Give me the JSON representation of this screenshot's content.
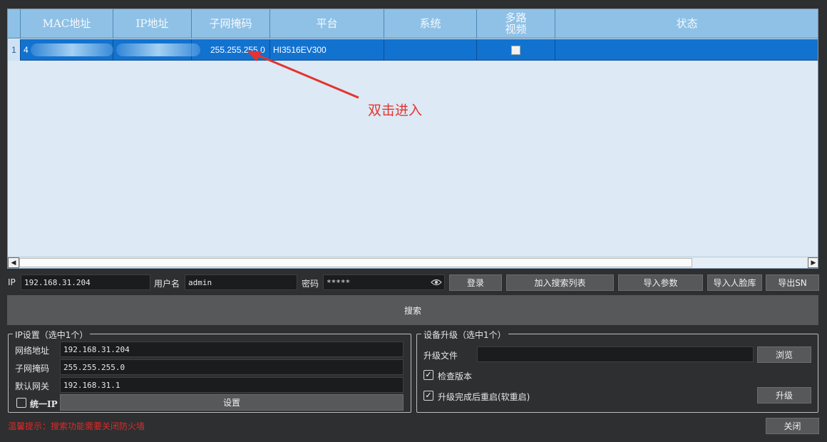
{
  "table": {
    "columns": [
      "MAC地址",
      "IP地址",
      "子网掩码",
      "平台",
      "系统",
      "多路\n视频",
      "状态"
    ],
    "rows": [
      {
        "index": "1",
        "mac": "4",
        "ip": "",
        "mask": "255.255.255.0",
        "platform": "HI3516EV300",
        "system": "",
        "multi_video": false,
        "status": ""
      }
    ]
  },
  "annotation": {
    "text": "双击进入",
    "color": "#e3342f"
  },
  "login": {
    "ip_label": "IP",
    "ip_value": "192.168.31.204",
    "user_label": "用户名",
    "user_value": "admin",
    "pwd_label": "密码",
    "pwd_value": "*****",
    "login_button": "登录",
    "add_to_list_button": "加入搜索列表",
    "import_params_button": "导入参数",
    "import_face_button": "导入人脸库",
    "export_sn_button": "导出SN"
  },
  "search_button": "搜索",
  "ip_settings": {
    "title": "IP设置（选中1个）",
    "address_label": "网络地址",
    "address_value": "192.168.31.204",
    "mask_label": "子网掩码",
    "mask_value": "255.255.255.0",
    "gateway_label": "默认网关",
    "gateway_value": "192.168.31.1",
    "unified_ip_label": "统一IP",
    "unified_ip_checked": false,
    "set_button": "设置"
  },
  "upgrade": {
    "title": "设备升级（选中1个）",
    "file_label": "升级文件",
    "file_value": "",
    "browse_button": "浏览",
    "check_version_label": "检查版本",
    "check_version_checked": true,
    "reboot_label": "升级完成后重启(软重启)",
    "reboot_checked": true,
    "upgrade_button": "升级"
  },
  "warning_text": "温馨提示：搜索功能需要关闭防火墙",
  "close_button": "关闭",
  "colors": {
    "header": "#8fc1e6",
    "selected_row": "#1272d0",
    "window_bg": "#2d2f30",
    "warning": "#e12a2a"
  }
}
